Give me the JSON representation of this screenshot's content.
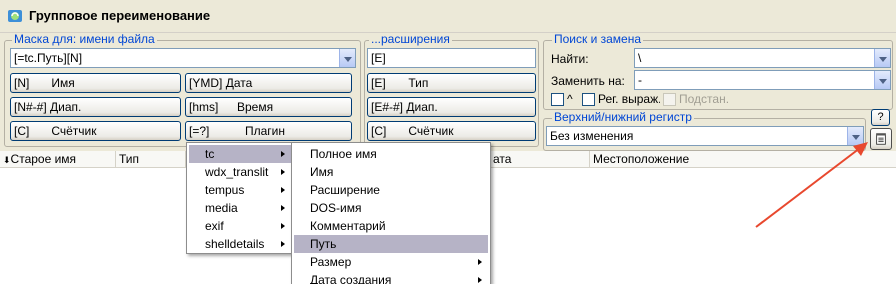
{
  "window": {
    "title": "Групповое переименование"
  },
  "mask": {
    "title": "Маска для: имени файла",
    "value": "[=tc.Путь][N]",
    "buttons": [
      {
        "code": "[N]",
        "label": "Имя"
      },
      {
        "code": "[YMD]",
        "label": "Дата"
      },
      {
        "code": "[N#-#]",
        "label": "Диап."
      },
      {
        "code": "[hms]",
        "label": "Время"
      },
      {
        "code": "[C]",
        "label": "Счётчик"
      },
      {
        "code": "[=?]",
        "label": "Плагин"
      }
    ]
  },
  "ext": {
    "title": "...расширения",
    "value": "[E]",
    "buttons": [
      {
        "code": "[E]",
        "label": "Тип"
      },
      {
        "code": "[E#-#]",
        "label": "Диап."
      },
      {
        "code": "[C]",
        "label": "Счётчик"
      }
    ]
  },
  "search": {
    "title": "Поиск и замена",
    "find_label": "Найти:",
    "find_value": "\\",
    "replace_label": "Заменить на:",
    "replace_value": "-",
    "caret_option": "^",
    "regex_option": "Рег. выраж.",
    "subst_option": "Подстан."
  },
  "case": {
    "title": "Верхний/нижний регистр",
    "value": "Без изменения"
  },
  "help_button": "?",
  "list": {
    "columns": [
      "Старое имя",
      "Тип",
      "",
      "",
      "ата",
      "Местоположение"
    ]
  },
  "plugin_menu": {
    "items": [
      "tc",
      "wdx_translit",
      "tempus",
      "media",
      "exif",
      "shelldetails"
    ],
    "selected_index": 0
  },
  "field_menu": {
    "items": [
      "Полное имя",
      "Имя",
      "Расширение",
      "DOS-имя",
      "Комментарий",
      "Путь",
      "Размер",
      "Дата создания"
    ],
    "selected_index": 5
  },
  "colors": {
    "accent": "#0046d5",
    "arrow": "#e8482e",
    "menu_selection": "#b6b3c6"
  }
}
